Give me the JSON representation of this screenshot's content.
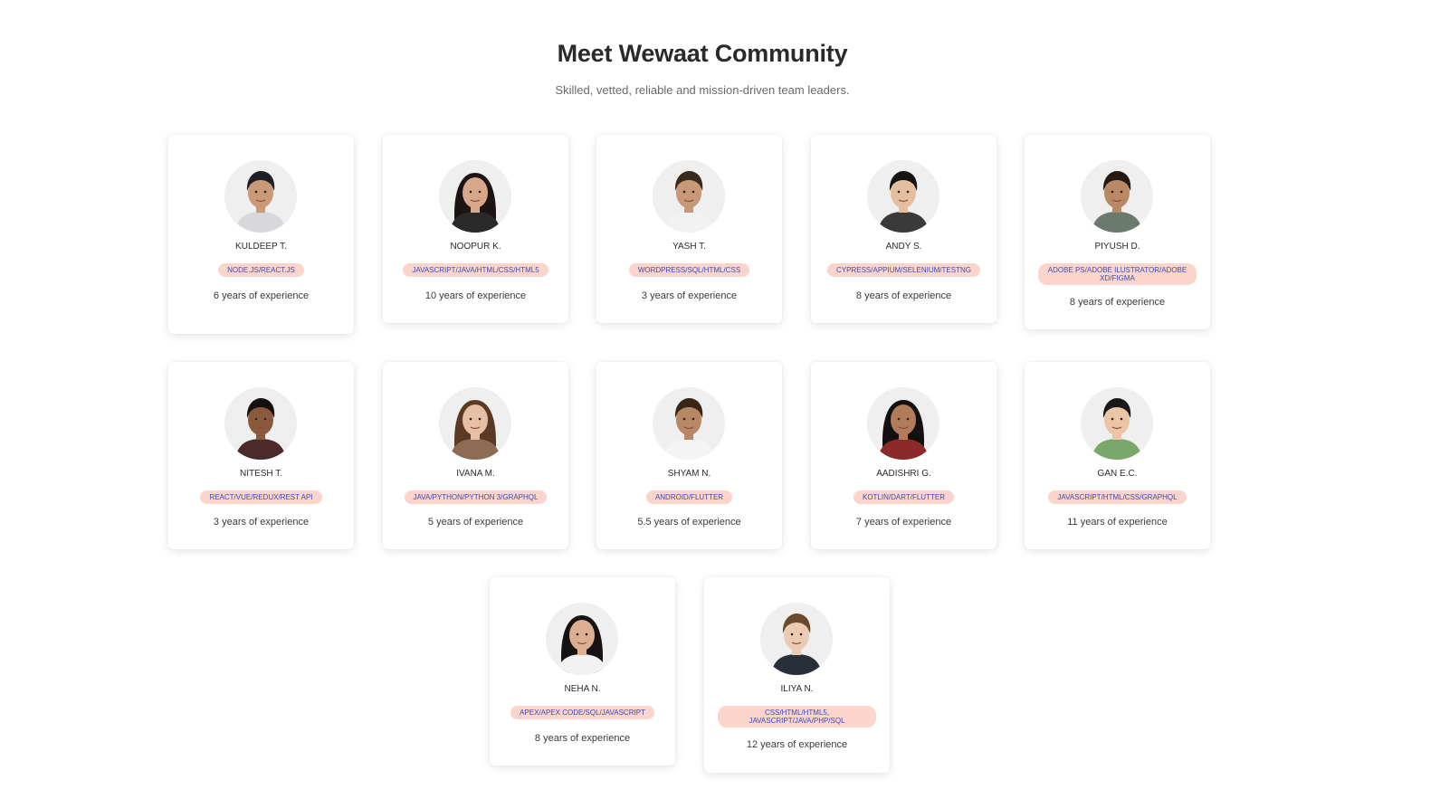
{
  "header": {
    "title": "Meet Wewaat Community",
    "subtitle": "Skilled, vetted, reliable and mission-driven team leaders."
  },
  "colors": {
    "tag_background": "#fbd5cc",
    "tag_text": "#3a4bb8",
    "avatar_background": "#efefef"
  },
  "members": [
    {
      "name": "KULDEEP T.",
      "skills": "NODE.JS/REACT.JS",
      "experience": "6 years of experience"
    },
    {
      "name": "NOOPUR K.",
      "skills": "JAVASCRIPT/JAVA/HTML/CSS/HTML5",
      "experience": "10 years of experience"
    },
    {
      "name": "YASH T.",
      "skills": "WORDPRESS/SQL/HTML/CSS",
      "experience": "3 years of experience"
    },
    {
      "name": "ANDY S.",
      "skills": "CYPRESS/APPIUM/SELENIUM/TESTNG",
      "experience": "8 years of experience"
    },
    {
      "name": "PIYUSH D.",
      "skills": "ADOBE PS/ADOBE ILUSTRATOR/ADOBE XD/FIGMA",
      "experience": "8 years of experience"
    },
    {
      "name": "NITESH T.",
      "skills": "REACT/VUE/REDUX/REST API",
      "experience": "3 years of experience"
    },
    {
      "name": "IVANA M.",
      "skills": "JAVA/PYTHON/PYTHON 3/GRAPHQL",
      "experience": "5 years of experience"
    },
    {
      "name": "SHYAM N.",
      "skills": "ANDROID/FLUTTER",
      "experience": "5.5 years of experience"
    },
    {
      "name": "AADISHRI G.",
      "skills": "KOTLIN/DART/FLUTTER",
      "experience": "7 years of experience"
    },
    {
      "name": "GAN E.C.",
      "skills": "JAVASCRIPT/HTML/CSS/GRAPHQL",
      "experience": "11 years of experience"
    },
    {
      "name": "NEHA N.",
      "skills": "APEX/APEX CODE/SQL/JAVASCRIPT",
      "experience": "8 years of experience"
    },
    {
      "name": "ILIYA N.",
      "skills": "CSS/HTML/HTML5, JAVASCRIPT/JAVA/PHP/SQL",
      "experience": "12 years of experience"
    }
  ]
}
